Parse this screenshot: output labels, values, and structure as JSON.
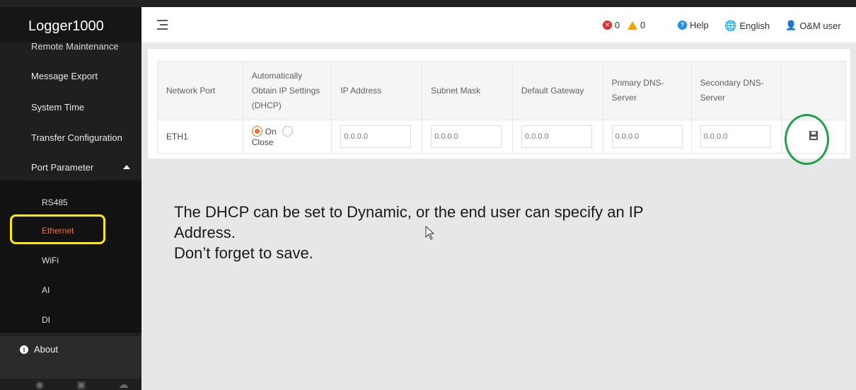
{
  "app": {
    "title": "Logger1000"
  },
  "sidebar": {
    "items": [
      {
        "label": "Remote Maintenance"
      },
      {
        "label": "Message Export"
      },
      {
        "label": "System Time"
      },
      {
        "label": "Transfer Configuration"
      },
      {
        "label": "Port Parameter"
      }
    ],
    "subitems": [
      {
        "label": "RS485"
      },
      {
        "label": "Ethernet"
      },
      {
        "label": "WiFi"
      },
      {
        "label": "AI"
      },
      {
        "label": "DI"
      }
    ],
    "about": "About",
    "bottom_icons": [
      "wifi-icon",
      "sim-icon",
      "cloud-icon"
    ]
  },
  "header": {
    "error_count": "0",
    "warning_count": "0",
    "help": "Help",
    "language": "English",
    "user": "O&M user"
  },
  "table": {
    "headers": [
      "Network Port",
      "Automatically Obtain IP Settings (DHCP)",
      "IP Address",
      "Subnet Mask",
      "Default Gateway",
      "Primary DNS-Server",
      "Secondary DNS-Server",
      ""
    ],
    "row": {
      "port": "ETH1",
      "dhcp_on": "On",
      "dhcp_close": "Close",
      "ip_placeholder": "0.0.0.0",
      "mask_placeholder": "0.0.0.0",
      "gateway_placeholder": "0.0.0.0",
      "dns1_placeholder": "0.0.0.0",
      "dns2_placeholder": "0.0.0.0"
    }
  },
  "note": {
    "line1": "The DHCP can be set to Dynamic, or the end user can specify an IP",
    "line2": "Address.",
    "line3": "Don’t forget to save."
  },
  "colors": {
    "accent": "#f0712d",
    "highlight_yellow": "#ffe800",
    "highlight_green": "#17a349",
    "error_red": "#e02d2d",
    "warning_orange": "#f0a400",
    "help_blue": "#1e8ef0"
  }
}
